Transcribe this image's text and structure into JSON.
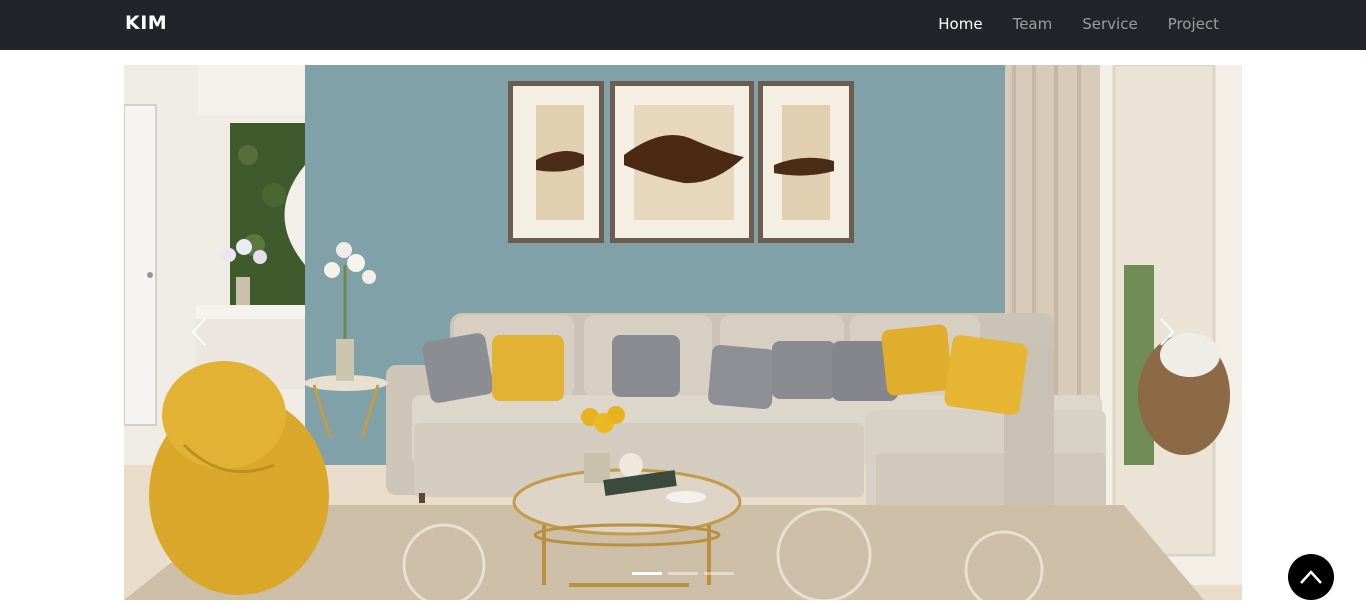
{
  "navbar": {
    "brand": "KIM",
    "links": [
      {
        "label": "Home",
        "active": true
      },
      {
        "label": "Team",
        "active": false
      },
      {
        "label": "Service",
        "active": false
      },
      {
        "label": "Project",
        "active": false
      }
    ]
  },
  "carousel": {
    "slide_count": 3,
    "active_slide": 1,
    "prev_icon": "chevron-left-icon",
    "next_icon": "chevron-right-icon"
  },
  "back_to_top": {
    "icon": "chevron-up-icon",
    "color": "#000000"
  },
  "colors": {
    "navbar_bg": "#212529",
    "wall": "#7fa1a7",
    "sofa": "#d8d2c6",
    "accent_yellow": "#e2b234"
  }
}
